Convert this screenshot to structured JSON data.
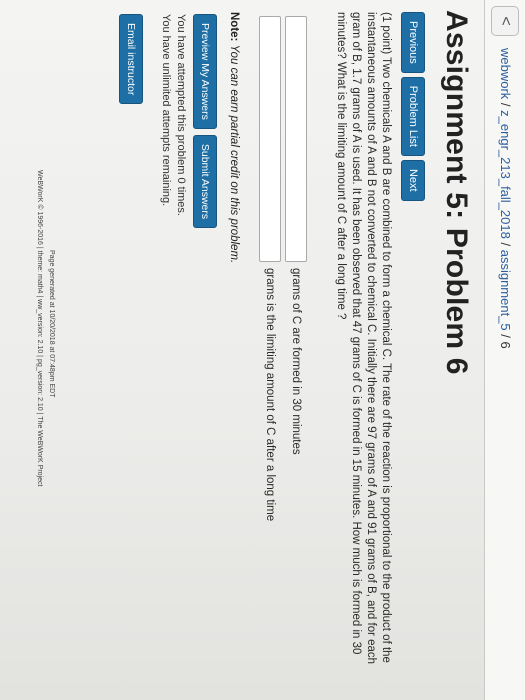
{
  "breadcrumb": {
    "back_symbol": "<",
    "parts": [
      "webwork",
      "z_engr_213_fall_2018",
      "assignment_5",
      "6"
    ],
    "separator": "/"
  },
  "title": "Assignment 5: Problem 6",
  "nav": {
    "previous": "Previous",
    "problem_list": "Problem List",
    "next": "Next"
  },
  "problem": {
    "text": "(1 point) Two chemicals A and B are combined to form a chemical C. The rate of the reaction is proportional to the product of the instantaneous amounts of A and B not converted to chemical C. Initially there are 97 grams of A and 91 grams of B, and for each gram of B, 1.7 grams of A is used. It has been observed that 47 grams of C is formed in 15 minutes. How much is formed in 30 minutes? What is the limiting amount of C after a long time ?"
  },
  "answers": [
    {
      "value": "",
      "label": "grams of C are formed in 30 minutes"
    },
    {
      "value": "",
      "label": "grams is the limiting amount of C after a long time"
    }
  ],
  "note": {
    "prefix": "Note:",
    "text": "You can earn partial credit on this problem."
  },
  "actions": {
    "preview": "Preview My Answers",
    "submit": "Submit Answers"
  },
  "status": {
    "attempts": "You have attempted this problem 0 times.",
    "remaining": "You have unlimited attempts remaining."
  },
  "email_instructor": "Email instructor",
  "footer": {
    "generated": "Page generated at 10/20/2018 at 07:48pm EDT",
    "credits": "WeBWorK © 1996-2016 | theme: math4 | ww_version: 2.10 | pg_version: 2.10 | The WeBWorK Project"
  },
  "colors": {
    "button": "#1d6fa5",
    "link": "#2c5f9e"
  }
}
